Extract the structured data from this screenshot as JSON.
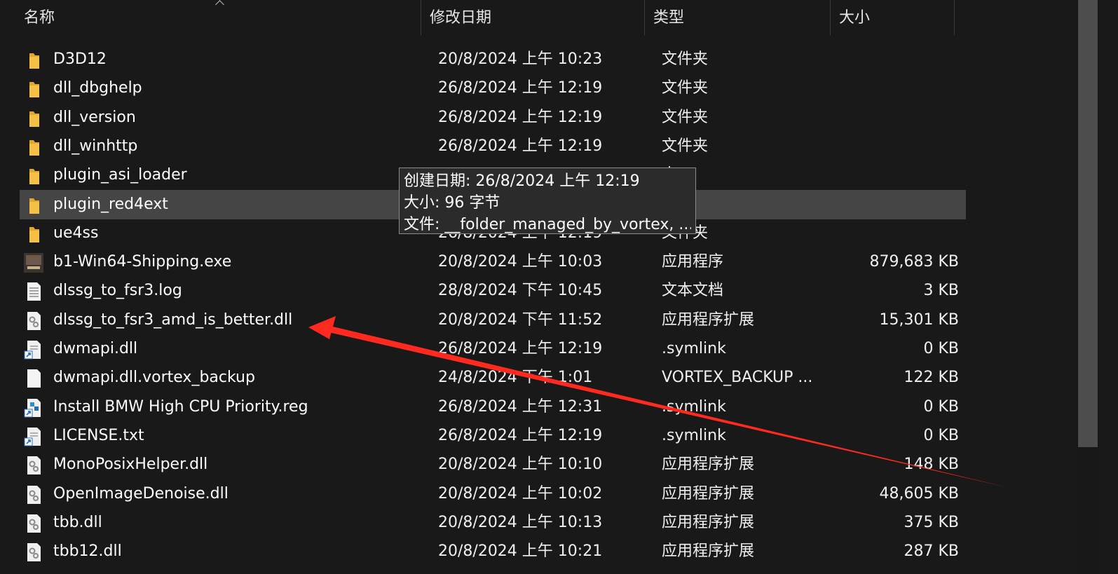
{
  "columns": {
    "name": "名称",
    "date": "修改日期",
    "type": "类型",
    "size": "大小"
  },
  "files": [
    {
      "name": "D3D12",
      "date": "20/8/2024 上午 10:23",
      "type": "文件夹",
      "size": "",
      "icon": "folder-icon"
    },
    {
      "name": "dll_dbghelp",
      "date": "26/8/2024 上午 12:19",
      "type": "文件夹",
      "size": "",
      "icon": "folder-icon"
    },
    {
      "name": "dll_version",
      "date": "26/8/2024 上午 12:19",
      "type": "文件夹",
      "size": "",
      "icon": "folder-icon"
    },
    {
      "name": "dll_winhttp",
      "date": "26/8/2024 上午 12:19",
      "type": "文件夹",
      "size": "",
      "icon": "folder-icon"
    },
    {
      "name": "plugin_asi_loader",
      "date": "",
      "type": "夹",
      "size": "",
      "icon": "folder-icon"
    },
    {
      "name": "plugin_red4ext",
      "date": "",
      "type": "夹",
      "size": "",
      "icon": "folder-icon"
    },
    {
      "name": "ue4ss",
      "date": "26/8/2024 上午 12:19",
      "type": "文件夹",
      "size": "",
      "icon": "folder-icon"
    },
    {
      "name": "b1-Win64-Shipping.exe",
      "date": "20/8/2024 上午 10:03",
      "type": "应用程序",
      "size": "879,683 KB",
      "icon": "game-exe-icon"
    },
    {
      "name": "dlssg_to_fsr3.log",
      "date": "28/8/2024 下午 10:45",
      "type": "文本文档",
      "size": "3 KB",
      "icon": "text-file-icon"
    },
    {
      "name": "dlssg_to_fsr3_amd_is_better.dll",
      "date": "20/8/2024 下午 11:52",
      "type": "应用程序扩展",
      "size": "15,301 KB",
      "icon": "dll-file-icon"
    },
    {
      "name": "dwmapi.dll",
      "date": "26/8/2024 上午 12:19",
      "type": ".symlink",
      "size": "0 KB",
      "icon": "symlink-file-icon"
    },
    {
      "name": "dwmapi.dll.vortex_backup",
      "date": "24/8/2024 下午 1:01",
      "type": "VORTEX_BACKUP ...",
      "size": "122 KB",
      "icon": "blank-file-icon"
    },
    {
      "name": "Install BMW High CPU Priority.reg",
      "date": "26/8/2024 上午 12:31",
      "type": ".symlink",
      "size": "0 KB",
      "icon": "registry-file-icon"
    },
    {
      "name": "LICENSE.txt",
      "date": "26/8/2024 上午 12:19",
      "type": ".symlink",
      "size": "0 KB",
      "icon": "symlink-file-icon"
    },
    {
      "name": "MonoPosixHelper.dll",
      "date": "20/8/2024 上午 10:10",
      "type": "应用程序扩展",
      "size": "148 KB",
      "icon": "dll-file-icon"
    },
    {
      "name": "OpenImageDenoise.dll",
      "date": "20/8/2024 上午 10:02",
      "type": "应用程序扩展",
      "size": "48,605 KB",
      "icon": "dll-file-icon"
    },
    {
      "name": "tbb.dll",
      "date": "20/8/2024 上午 10:13",
      "type": "应用程序扩展",
      "size": "375 KB",
      "icon": "dll-file-icon"
    },
    {
      "name": "tbb12.dll",
      "date": "20/8/2024 上午 10:21",
      "type": "应用程序扩展",
      "size": "287 KB",
      "icon": "dll-file-icon"
    }
  ],
  "tooltip": {
    "created": "创建日期: 26/8/2024 上午 12:19",
    "size": "大小: 96 字节",
    "files": "文件: __folder_managed_by_vortex, ..."
  },
  "colors": {
    "background": "#191919",
    "hover_row": "#454545",
    "folder": "#f4c046",
    "annotation_arrow": "#ff2a1f"
  }
}
